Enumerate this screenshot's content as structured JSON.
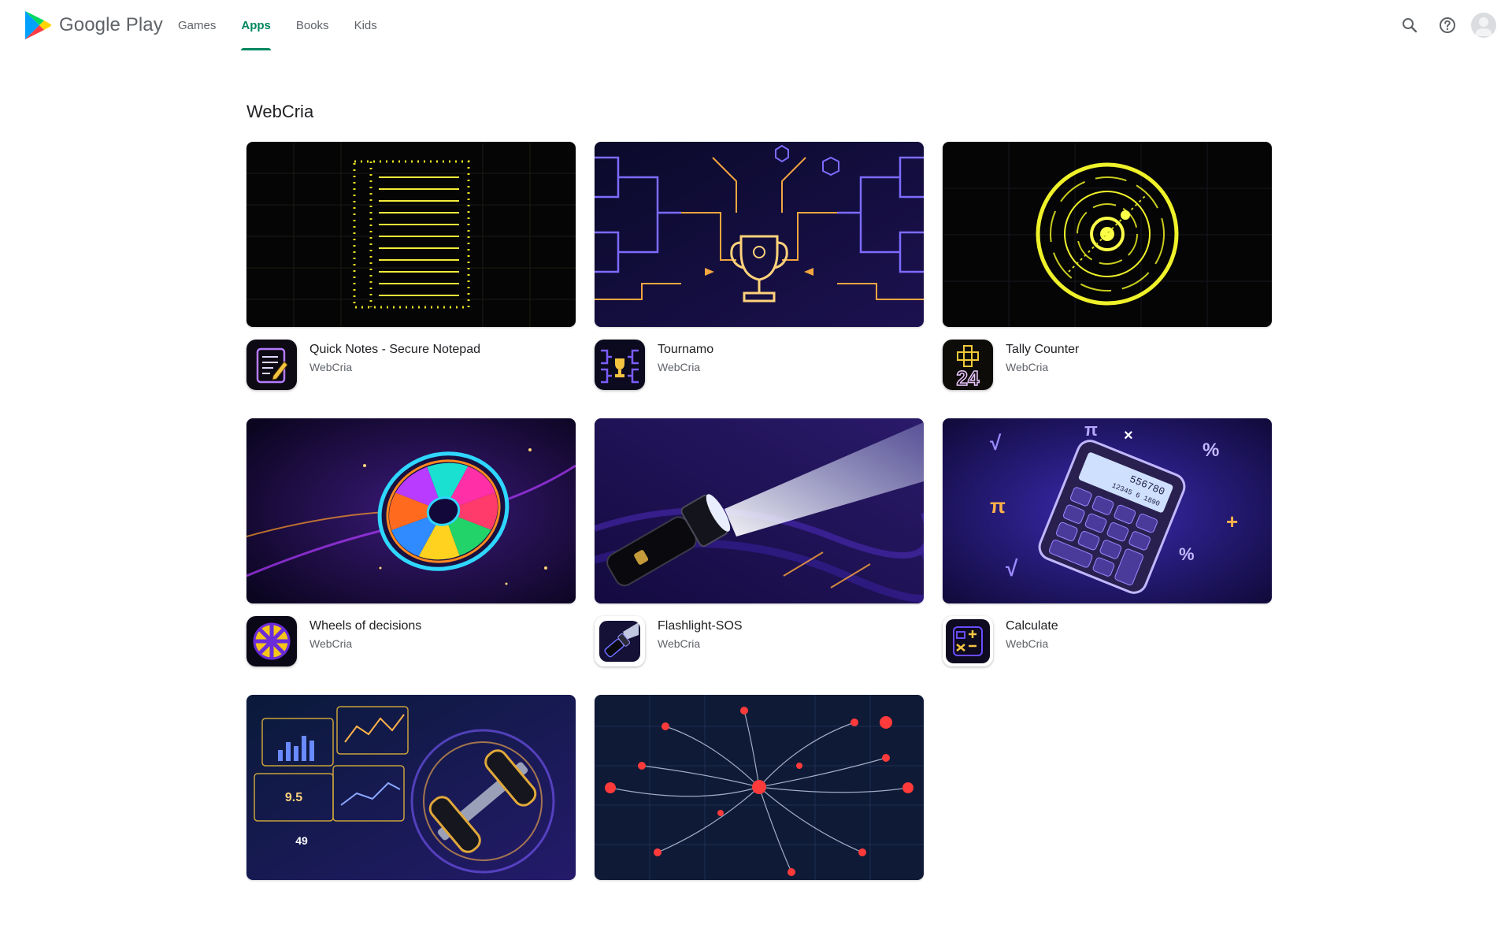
{
  "header": {
    "brand": "Google Play",
    "tabs": [
      {
        "label": "Games",
        "active": false
      },
      {
        "label": "Apps",
        "active": true
      },
      {
        "label": "Books",
        "active": false
      },
      {
        "label": "Kids",
        "active": false
      }
    ],
    "icons": [
      "search-icon",
      "help-icon",
      "account-avatar"
    ]
  },
  "colors": {
    "accent": "#01875f",
    "text_primary": "#202124",
    "text_secondary": "#5f6368"
  },
  "section": {
    "title": "WebCria",
    "apps": [
      {
        "name": "Quick Notes - Secure Notepad",
        "developer": "WebCria"
      },
      {
        "name": "Tournamo",
        "developer": "WebCria"
      },
      {
        "name": "Tally Counter",
        "developer": "WebCria"
      },
      {
        "name": "Wheels of decisions",
        "developer": "WebCria"
      },
      {
        "name": "Flashlight-SOS",
        "developer": "WebCria"
      },
      {
        "name": "Calculate",
        "developer": "WebCria"
      },
      {
        "name": "",
        "developer": ""
      },
      {
        "name": "",
        "developer": ""
      }
    ]
  },
  "banner_text": {
    "tally_icon": "24",
    "fitness_stat_1": "9.5",
    "fitness_stat_2": "49",
    "calc_display_1": "556780",
    "calc_display_2": "12345 6 1890"
  }
}
